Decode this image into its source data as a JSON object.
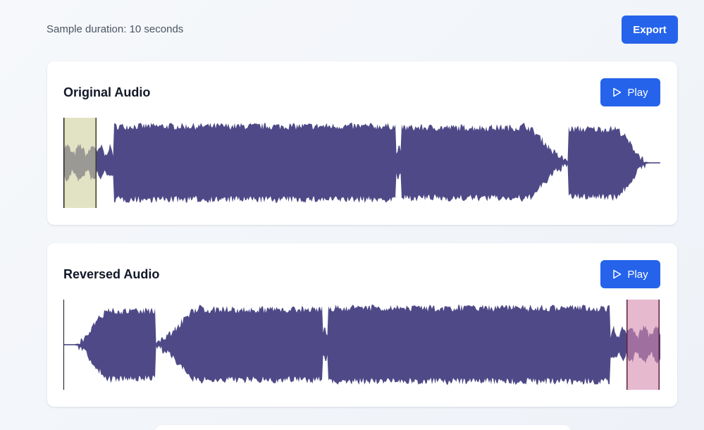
{
  "header": {
    "duration_text": "Sample duration: 10 seconds",
    "export_label": "Export"
  },
  "original": {
    "title": "Original Audio",
    "play_label": "Play",
    "wave_color": "#4f4a87",
    "highlight_color": "#cfcf9f",
    "highlight_position": "start"
  },
  "reversed": {
    "title": "Reversed Audio",
    "play_label": "Play",
    "wave_color": "#4f4a87",
    "highlight_color": "#d58aaf",
    "highlight_position": "end"
  },
  "colors": {
    "accent": "#2563eb",
    "page_background": "#f3f6fa",
    "card_background": "#ffffff"
  }
}
